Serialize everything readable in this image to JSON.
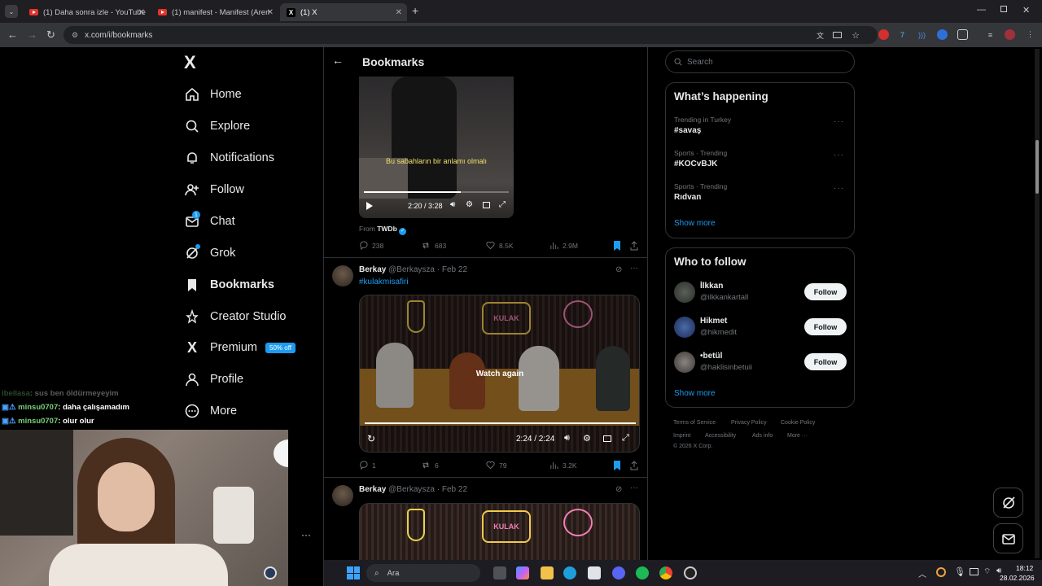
{
  "browser": {
    "tabs": [
      {
        "title": "(1) Daha sonra izle - YouTube"
      },
      {
        "title": "(1) manifest - Manifest (Arem &"
      },
      {
        "title": "(1) X"
      }
    ],
    "new_tab_label": "+",
    "url": "x.com/i/bookmarks"
  },
  "nav": {
    "logo": "X",
    "items": [
      {
        "label": "Home"
      },
      {
        "label": "Explore"
      },
      {
        "label": "Notifications"
      },
      {
        "label": "Follow"
      },
      {
        "label": "Chat"
      },
      {
        "label": "Grok"
      },
      {
        "label": "Bookmarks"
      },
      {
        "label": "Creator Studio"
      },
      {
        "label": "Premium"
      },
      {
        "label": "Profile"
      },
      {
        "label": "More"
      }
    ],
    "premium_badge": "50% off",
    "chat_badge": "1"
  },
  "header": {
    "title": "Bookmarks"
  },
  "posts": [
    {
      "subtitle": "Bu sabahların bir anlamı olmalı",
      "time": "2:20 / 3:28",
      "from_label": "From",
      "from_name": "TWDb",
      "progress": 0.67,
      "replies": "238",
      "reposts": "683",
      "likes": "8.5K",
      "views": "2.9M"
    },
    {
      "author": "Berkay",
      "handle": "@Berkaysza",
      "date": "· Feb 22",
      "text": "#kulakmisafiri",
      "overlay": "Watch again",
      "time": "2:24 / 2:24",
      "progress": 1.0,
      "replies": "1",
      "reposts": "6",
      "likes": "79",
      "views": "3.2K"
    },
    {
      "author": "Berkay",
      "handle": "@Berkaysza",
      "date": "· Feb 22"
    }
  ],
  "right": {
    "search_placeholder": "Search",
    "happening_title": "What’s happening",
    "trends": [
      {
        "meta": "Trending in Turkey",
        "name": "#savaş"
      },
      {
        "meta": "Sports · Trending",
        "name": "#KOCvBJK"
      },
      {
        "meta": "Sports · Trending",
        "name": "Rıdvan"
      }
    ],
    "show_more": "Show more",
    "wtf_title": "Who to follow",
    "follow": [
      {
        "name": "İlkkan",
        "handle": "@ilkkankartall",
        "button": "Follow"
      },
      {
        "name": "Hikmet",
        "handle": "@hikmedit",
        "button": "Follow"
      },
      {
        "name": "•betül",
        "handle": "@haklisinbetuii",
        "button": "Follow"
      }
    ],
    "footer": [
      "Terms of Service",
      "Privacy Policy",
      "Cookie Policy",
      "Imprint",
      "Accessibility",
      "Ads info",
      "More ···",
      "© 2026 X Corp."
    ]
  },
  "stream_chat": [
    {
      "user": "ibellasa",
      "msg": ": sus ben öldürmeyeyim"
    },
    {
      "user": "minsu0707",
      "msg": ": daha çalışamadım"
    },
    {
      "user": "minsu0707",
      "msg": ": olur olur"
    }
  ],
  "taskbar": {
    "search": "Ara",
    "time": "18:12",
    "date": "28.02.2026"
  },
  "colors": {
    "accent": "#1d9bf0",
    "bg": "#000000",
    "border": "#2f3336",
    "muted": "#71767b"
  }
}
